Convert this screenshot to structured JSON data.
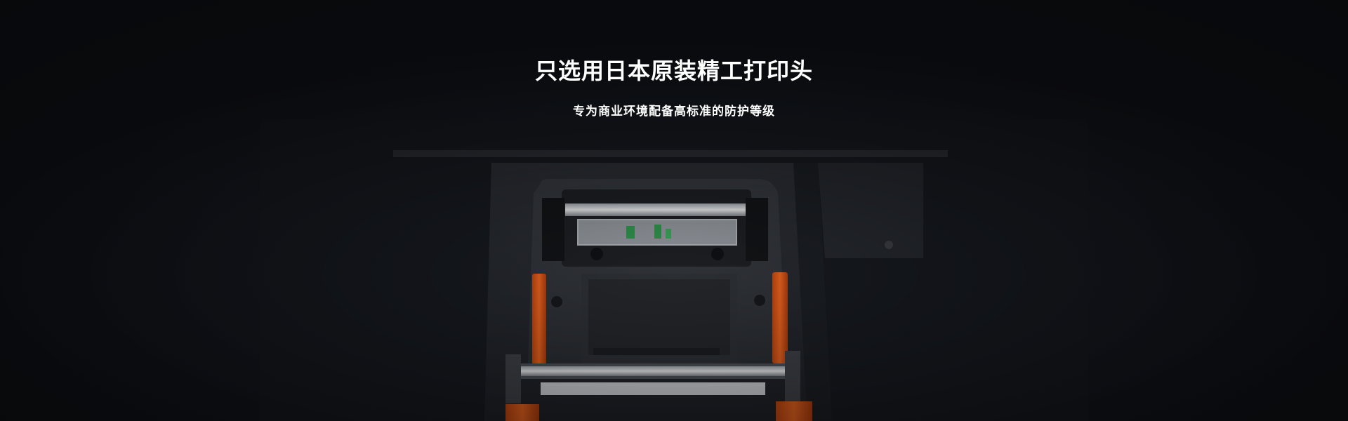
{
  "banner": {
    "headline": "只选用日本原装精工打印头",
    "subline": "专为商业环境配备高标准的防护等级"
  },
  "colors": {
    "background": "#14171e",
    "text": "#ffffff",
    "accent_orange": "#d8561d"
  }
}
